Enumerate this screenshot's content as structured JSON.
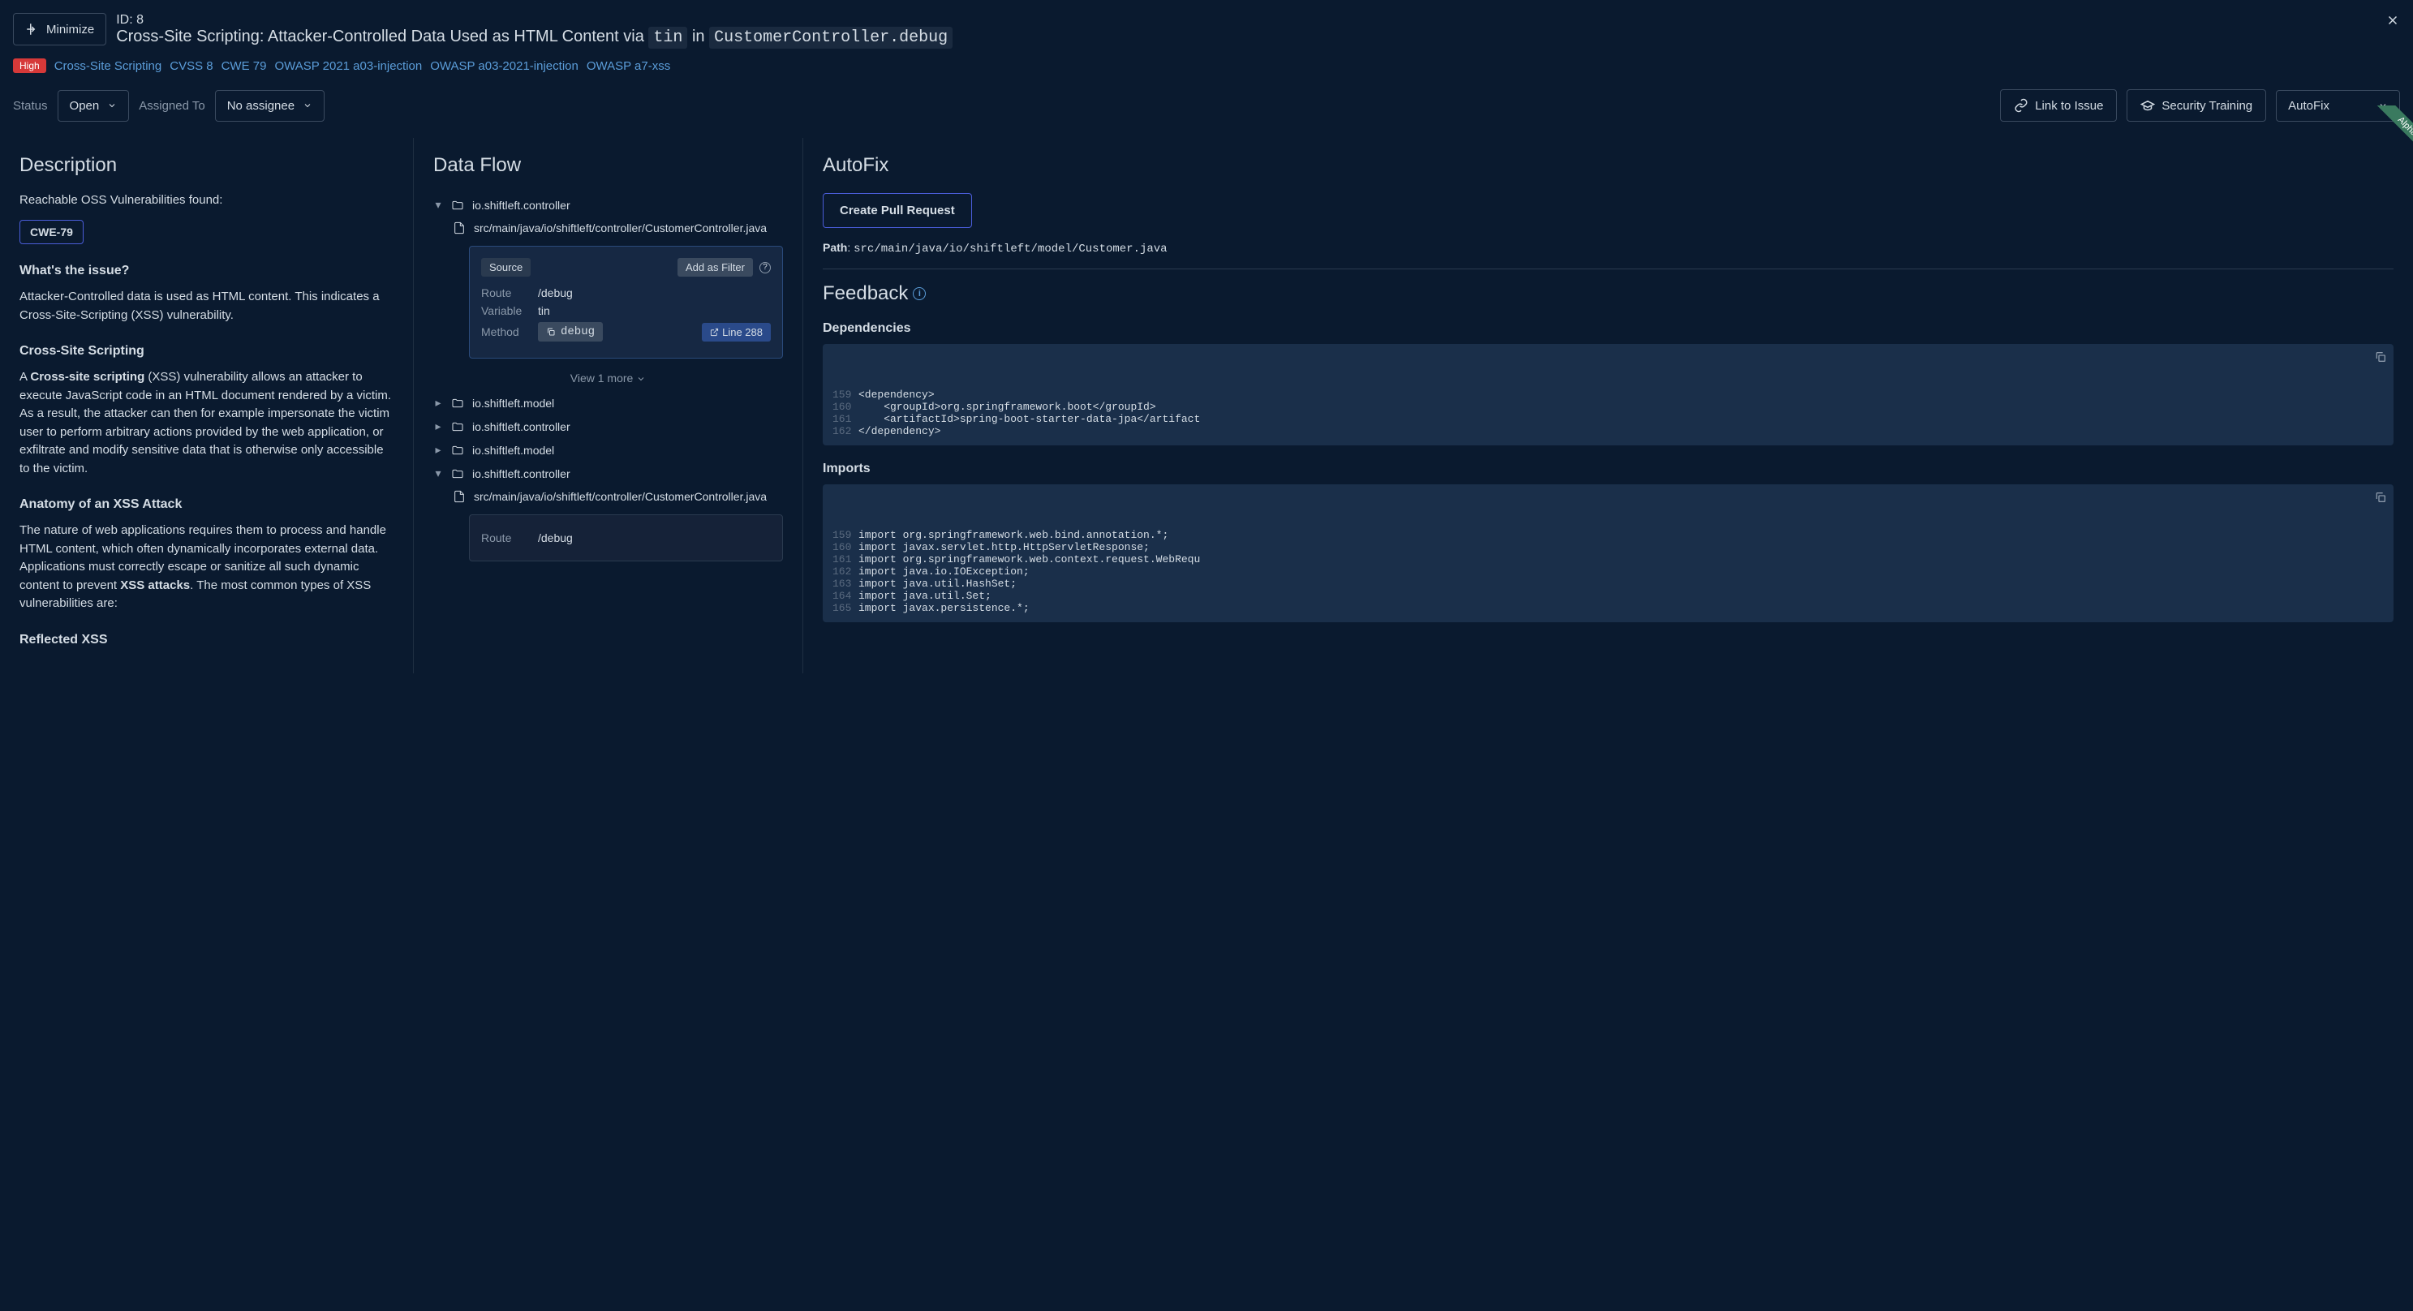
{
  "header": {
    "minimize": "Minimize",
    "id_label": "ID: 8",
    "title_prefix": "Cross-Site Scripting: Attacker-Controlled Data Used as HTML Content via ",
    "title_var": "tin",
    "title_mid": " in ",
    "title_loc": "CustomerController.debug",
    "severity": "High",
    "tags": [
      "Cross-Site Scripting",
      "CVSS 8",
      "CWE 79",
      "OWASP 2021 a03-injection",
      "OWASP a03-2021-injection",
      "OWASP a7-xss"
    ],
    "status_label": "Status",
    "status_value": "Open",
    "assigned_label": "Assigned To",
    "assigned_value": "No assignee",
    "link_issue": "Link to Issue",
    "security_training": "Security Training",
    "autofix": "AutoFix",
    "alpha": "Alpha"
  },
  "description": {
    "title": "Description",
    "reachable": "Reachable OSS Vulnerabilities found:",
    "cwe_btn": "CWE-79",
    "whats_issue": "What's the issue?",
    "issue_text": "Attacker-Controlled data is used as HTML content. This indicates a Cross-Site-Scripting (XSS) vulnerability.",
    "xss_heading": "Cross-Site Scripting",
    "xss_para_1a": "A ",
    "xss_para_1b": "Cross-site scripting",
    "xss_para_1c": " (XSS) vulnerability allows an attacker to execute JavaScript code in an HTML document rendered by a victim. As a result, the attacker can then for example impersonate the victim user to perform arbitrary actions provided by the web application, or exfiltrate and modify sensitive data that is otherwise only accessible to the victim.",
    "anatomy_heading": "Anatomy of an XSS Attack",
    "anatomy_para_a": "The nature of web applications requires them to process and handle HTML content, which often dynamically incorporates external data. Applications must correctly escape or sanitize all such dynamic content to prevent ",
    "anatomy_para_b": "XSS attacks",
    "anatomy_para_c": ". The most common types of XSS vulnerabilities are:",
    "reflected": "Reflected XSS"
  },
  "dataflow": {
    "title": "Data Flow",
    "packages": [
      {
        "name": "io.shiftleft.controller",
        "expanded": true,
        "file": "src/main/java/io/shiftleft/controller/CustomerController.java"
      },
      {
        "name": "io.shiftleft.model",
        "expanded": false
      },
      {
        "name": "io.shiftleft.controller",
        "expanded": false
      },
      {
        "name": "io.shiftleft.model",
        "expanded": false
      },
      {
        "name": "io.shiftleft.controller",
        "expanded": true,
        "file": "src/main/java/io/shiftleft/controller/CustomerController.java"
      }
    ],
    "source_badge": "Source",
    "filter_badge": "Add as Filter",
    "route_label": "Route",
    "route_val": "/debug",
    "variable_label": "Variable",
    "variable_val": "tin",
    "method_label": "Method",
    "method_val": "debug",
    "line_label": "Line 288",
    "view_more": "View 1 more",
    "route2_label": "Route",
    "route2_val": "/debug"
  },
  "autofix": {
    "title": "AutoFix",
    "create_pr": "Create Pull Request",
    "path_label": "Path",
    "path_val": "src/main/java/io/shiftleft/model/Customer.java",
    "feedback": "Feedback",
    "deps_heading": "Dependencies",
    "deps_lines": [
      {
        "n": "159",
        "t": "<dependency>"
      },
      {
        "n": "160",
        "t": "    <groupId>org.springframework.boot</groupId>"
      },
      {
        "n": "161",
        "t": "    <artifactId>spring-boot-starter-data-jpa</artifact"
      },
      {
        "n": "162",
        "t": "</dependency>"
      }
    ],
    "imports_heading": "Imports",
    "imports_lines": [
      {
        "n": "159",
        "t": "import org.springframework.web.bind.annotation.*;"
      },
      {
        "n": "160",
        "t": "import javax.servlet.http.HttpServletResponse;"
      },
      {
        "n": "161",
        "t": "import org.springframework.web.context.request.WebRequ"
      },
      {
        "n": "162",
        "t": "import java.io.IOException;"
      },
      {
        "n": "163",
        "t": "import java.util.HashSet;"
      },
      {
        "n": "164",
        "t": "import java.util.Set;"
      },
      {
        "n": "165",
        "t": "import javax.persistence.*;"
      }
    ]
  }
}
